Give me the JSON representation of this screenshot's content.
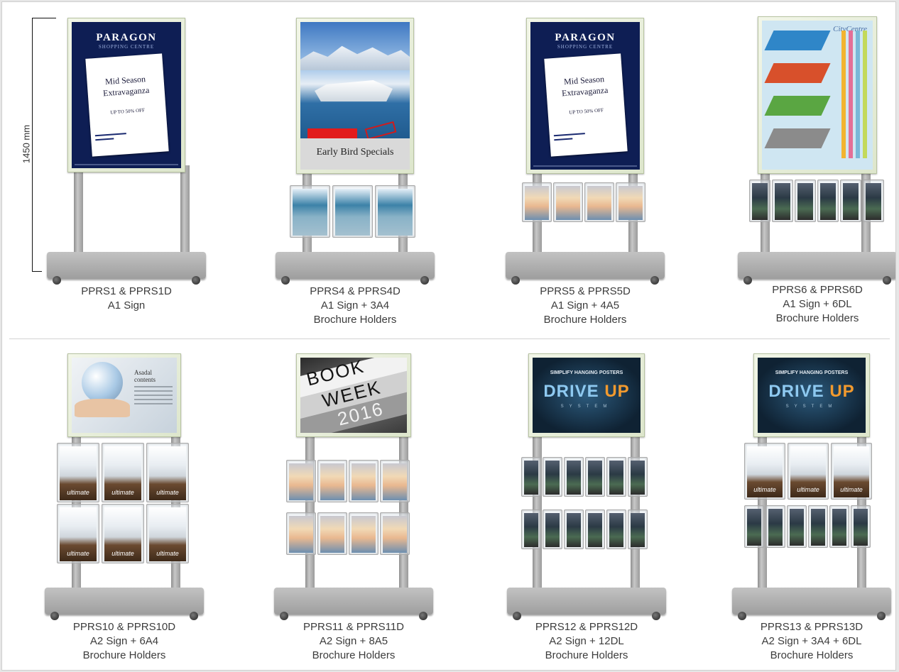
{
  "dimension": {
    "label": "1450 mm"
  },
  "products": [
    {
      "lines": [
        "PPRS1 & PPRS1D",
        "A1 Sign"
      ]
    },
    {
      "lines": [
        "PPRS4 & PPRS4D",
        "A1 Sign + 3A4",
        "Brochure Holders"
      ]
    },
    {
      "lines": [
        "PPRS5 & PPRS5D",
        "A1 Sign + 4A5",
        "Brochure Holders"
      ]
    },
    {
      "lines": [
        "PPRS6 & PPRS6D",
        "A1 Sign + 6DL",
        "Brochure Holders"
      ]
    },
    {
      "lines": [
        "PPRS10 & PPRS10D",
        "A2 Sign + 6A4",
        "Brochure Holders"
      ]
    },
    {
      "lines": [
        "PPRS11 & PPRS11D",
        "A2 Sign + 8A5",
        "Brochure Holders"
      ]
    },
    {
      "lines": [
        "PPRS12 & PPRS12D",
        "A2 Sign + 12DL",
        "Brochure Holders"
      ]
    },
    {
      "lines": [
        "PPRS13 & PPRS13D",
        "A2 Sign + 3A4 + 6DL",
        "Brochure Holders"
      ]
    }
  ],
  "posters": {
    "paragon": {
      "name": "PARAGON",
      "sub": "SHOPPING CENTRE",
      "headline_1": "Mid Season",
      "headline_2": "Extravaganza",
      "offer": "UP TO 50% OFF"
    },
    "cruise": {
      "title": "Early Bird Specials"
    },
    "mall": {
      "title": "CityCentre"
    },
    "world": {
      "title": "Asadal contents"
    },
    "bookweek": {
      "word_1": "BOOK",
      "word_2": "WEEK",
      "word_3": "2016"
    },
    "drive": {
      "tagline": "SIMPLIFY HANGING POSTERS",
      "logo_left": "DRIVE",
      "logo_right": "UP",
      "system": "SYSTEM"
    },
    "brochure": {
      "ultimate": "ultimate"
    }
  }
}
